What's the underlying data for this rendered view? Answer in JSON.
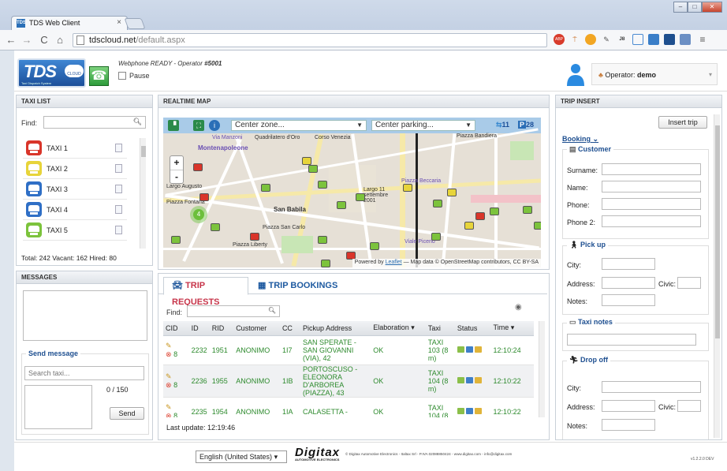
{
  "browser": {
    "tab_title": "TDS Web Client",
    "tab_close": "×",
    "url_host": "tdscloud.net",
    "url_path": "/default.aspx",
    "ext_abp": "ABP"
  },
  "header": {
    "logo_text": "TDS",
    "logo_cloud": "CLOUD",
    "logo_sub": "Taxi Dispatch System",
    "webphone_status_prefix": "Webphone READY - Operator ",
    "webphone_operator_id": "#5001",
    "pause_label": "Pause",
    "operator_label": "Operator: ",
    "operator_name": "demo"
  },
  "taxi_list": {
    "title": "TAXI LIST",
    "find_label": "Find:",
    "items": [
      {
        "label": "TAXI 1",
        "color": "#d9352a"
      },
      {
        "label": "TAXI 2",
        "color": "#e7d43a"
      },
      {
        "label": "TAXI 3",
        "color": "#2f6fc6"
      },
      {
        "label": "TAXI 4",
        "color": "#2f6fc6"
      },
      {
        "label": "TAXI 5",
        "color": "#7cc33c"
      }
    ],
    "totals": "Total: 242   Vacant: 162   Hired: 80"
  },
  "messages": {
    "title": "MESSAGES",
    "send_legend": "Send message",
    "search_placeholder": "Search taxi...",
    "counter": "0 / 150",
    "send_button": "Send"
  },
  "map": {
    "title": "REALTIME MAP",
    "center_zone": "Center zone...",
    "center_parking": "Center parking...",
    "count_taxi": "11",
    "count_parking": "28",
    "zoom_in": "+",
    "zoom_out": "-",
    "attribution_prefix": "Powered by ",
    "attribution_link": "Leaflet",
    "attribution_suffix": " — Map data © OpenStreetMap contributors, CC BY-SA",
    "labels": [
      "Montenapoleone",
      "San Babila",
      "Piazza Liberty",
      "Piazza San Carlo",
      "Largo Augusto",
      "Piazza Fontana",
      "Via Manzoni",
      "Corso Venezia",
      "Quadrilatero d'Oro",
      "Piazza Beccaria",
      "Piazza Bandiera",
      "Largo 11 settembre 2001",
      "Viale Piceno"
    ],
    "cluster": "4"
  },
  "trips": {
    "tab_requests": "TRIP REQUESTS",
    "tab_bookings": "TRIP BOOKINGS",
    "find_label": "Find:",
    "columns": [
      "CID",
      "ID",
      "RID",
      "Customer",
      "CC",
      "Pickup Address",
      "Elaboration ▾",
      "Taxi",
      "Status",
      "Time ▾"
    ],
    "rows": [
      {
        "cid": "8",
        "id": "2232",
        "rid": "1951",
        "customer": "ANONIMO",
        "cc": "1I7",
        "pickup": "SAN SPERATE - SAN GIOVANNI (VIA), 42",
        "elab": "OK",
        "taxi": "TAXI 103 (8 m)",
        "time": "12:10:24"
      },
      {
        "cid": "8",
        "id": "2236",
        "rid": "1955",
        "customer": "ANONIMO",
        "cc": "1IB",
        "pickup": "PORTOSCUSO - ELEONORA D'ARBOREA (PIAZZA), 43",
        "elab": "OK",
        "taxi": "TAXI 104 (8 m)",
        "time": "12:10:22"
      },
      {
        "cid": "8",
        "id": "2235",
        "rid": "1954",
        "customer": "ANONIMO",
        "cc": "1IA",
        "pickup": "CALASETTA -",
        "elab": "OK",
        "taxi": "TAXI 104 (8",
        "time": "12:10:22"
      }
    ],
    "last_update": "Last update: 12:19:46"
  },
  "trip_insert": {
    "title": "TRIP INSERT",
    "insert_button": "Insert trip",
    "booking_link": "Booking",
    "customer_legend": "Customer",
    "surname_label": "Surname:",
    "name_label": "Name:",
    "phone_label": "Phone:",
    "phone2_label": "Phone 2:",
    "pickup_legend": "Pick up",
    "city_label": "City:",
    "address_label": "Address:",
    "civic_label": "Civic:",
    "notes_label": "Notes:",
    "taxi_notes_legend": "Taxi notes",
    "dropoff_legend": "Drop off",
    "city2_label": "City:",
    "address2_label": "Address:",
    "civic2_label": "Civic:",
    "notes2_label": "Notes:"
  },
  "footer": {
    "language": "English (United States)",
    "brand": "Digitax",
    "brand_sub": "AUTOMOTIVE ELECTRONICS",
    "company": "© Digitax Automotive Electronics - Italtax Srl - P.IVA 02088850424 - www.digitax.com - info@digitax.com",
    "version": "v1.2.2.0 DEV"
  }
}
